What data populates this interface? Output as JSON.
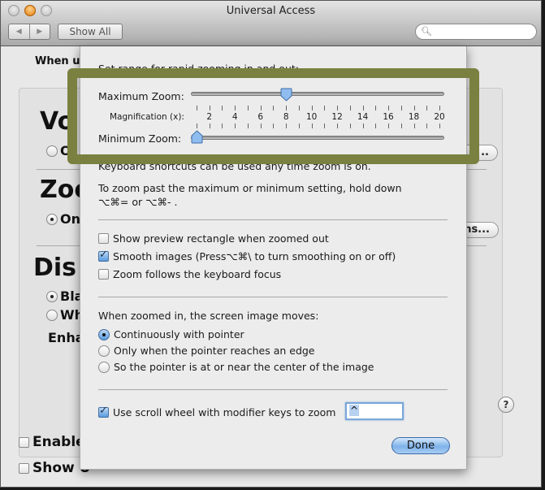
{
  "window": {
    "title": "Universal Access",
    "nav_back": "◀",
    "nav_forward": "▶",
    "show_all": "Show All",
    "search_placeholder": "",
    "search_icon": "magnifier-icon"
  },
  "background": {
    "when_using": "When us",
    "sections": [
      {
        "heading": "Vo",
        "option": "O",
        "option_selected": false
      },
      {
        "heading": "Zoo",
        "option": "On",
        "option_selected": true
      },
      {
        "heading": "Dis",
        "options": [
          {
            "label": "Bla",
            "selected": true
          },
          {
            "label": "Wh",
            "selected": false
          }
        ],
        "enhance": "Enha"
      }
    ],
    "voiceover_button_fragment": "..",
    "zoom_options_button_fragment": "ns...",
    "help": "?",
    "bottom_checks": [
      {
        "label": "Enable",
        "checked": false
      },
      {
        "label": "Show U",
        "checked": false
      }
    ]
  },
  "sheet": {
    "range_intro": "Set range for rapid zooming in and out:",
    "max_zoom_label": "Maximum Zoom:",
    "magnification_label": "Magnification (x):",
    "min_zoom_label": "Minimum Zoom:",
    "slider_min": 1,
    "slider_max": 20,
    "tick_labels": [
      "2",
      "4",
      "6",
      "8",
      "10",
      "12",
      "14",
      "16",
      "18",
      "20"
    ],
    "max_zoom_value": 8,
    "min_zoom_value": 1,
    "shortcut_note": "Keyboard shortcuts can be used any time zoom is on.",
    "past_note_line1": "To zoom past the maximum or minimum setting, hold down",
    "past_note_line2": "⌥⌘= or ⌥⌘- .",
    "checkboxes": [
      {
        "label": "Show preview rectangle when zoomed out",
        "checked": false
      },
      {
        "label": "Smooth images (Press⌥⌘\\ to turn smoothing on or off)",
        "checked": true
      },
      {
        "label": "Zoom follows the keyboard focus",
        "checked": false
      }
    ],
    "moves_heading": "When zoomed in, the screen image moves:",
    "moves_options": [
      {
        "label": "Continuously with pointer",
        "selected": true
      },
      {
        "label": "Only when the pointer reaches an edge",
        "selected": false
      },
      {
        "label": "So the pointer is at or near the center of the image",
        "selected": false
      }
    ],
    "scroll_wheel": {
      "label": "Use scroll wheel with modifier keys to zoom",
      "checked": true
    },
    "modifier_key_value": "^",
    "done": "Done"
  },
  "colors": {
    "highlight_frame": "#7a8040",
    "accent_blue": "#5a9ae0"
  }
}
